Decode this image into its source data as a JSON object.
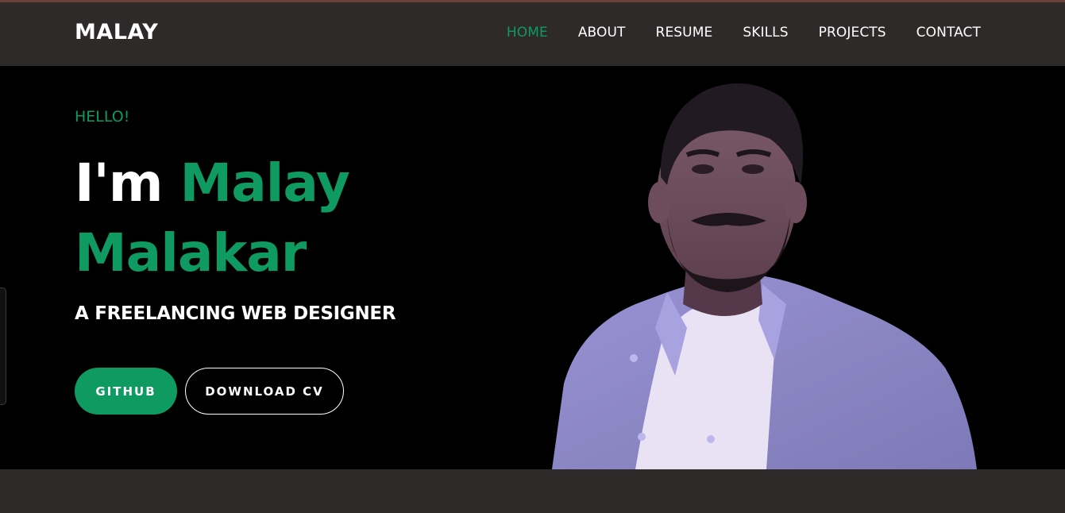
{
  "brand": {
    "name": "MALAY"
  },
  "nav": {
    "items": [
      {
        "label": "HOME",
        "active": true
      },
      {
        "label": "ABOUT",
        "active": false
      },
      {
        "label": "RESUME",
        "active": false
      },
      {
        "label": "SKILLS",
        "active": false
      },
      {
        "label": "PROJECTS",
        "active": false
      },
      {
        "label": "CONTACT",
        "active": false
      }
    ]
  },
  "hero": {
    "greeting": "HELLO!",
    "headline_prefix": "I'm",
    "headline_name": "Malay Malakar",
    "subtitle": "A FREELANCING WEB DESIGNER",
    "buttons": {
      "github": "GITHUB",
      "download_cv": "DOWNLOAD CV"
    },
    "portrait_icon": "person-portrait"
  },
  "colors": {
    "accent": "#0e9a60",
    "nav_background": "#2d2a29",
    "hero_background": "#000000",
    "text": "#ffffff"
  }
}
